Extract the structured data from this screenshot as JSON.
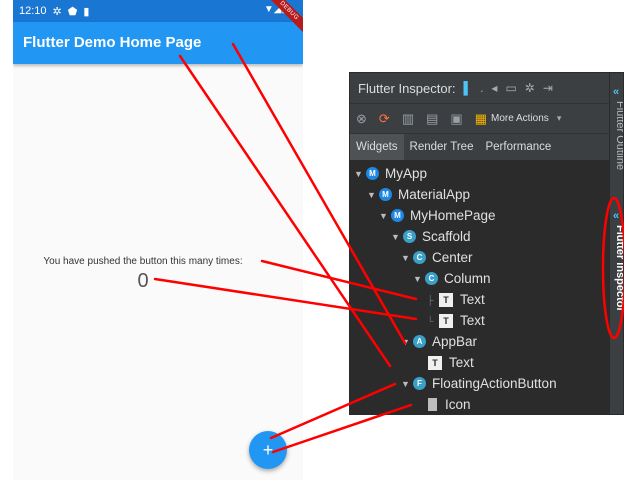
{
  "phone": {
    "status_time": "12:10",
    "debug_banner": "DEBUG",
    "appbar_title": "Flutter Demo Home Page",
    "counter_caption": "You have pushed the button this many times:",
    "counter_value": "0",
    "fab_glyph": "+"
  },
  "inspector": {
    "title": "Flutter Inspector:",
    "more_actions": "More Actions",
    "tabs": [
      {
        "label": "Widgets",
        "active": true
      },
      {
        "label": "Render Tree",
        "active": false
      },
      {
        "label": "Performance",
        "active": false
      }
    ],
    "tree": [
      {
        "label": "MyApp",
        "badge": "M",
        "expanded": true
      },
      {
        "label": "MaterialApp",
        "badge": "M",
        "expanded": true
      },
      {
        "label": "MyHomePage",
        "badge": "M",
        "expanded": true
      },
      {
        "label": "Scaffold",
        "badge": "S",
        "expanded": true
      },
      {
        "label": "Center",
        "badge": "C",
        "expanded": true
      },
      {
        "label": "Column",
        "badge": "C",
        "expanded": true
      },
      {
        "label": "Text",
        "badge": "T",
        "expanded": null
      },
      {
        "label": "Text",
        "badge": "T",
        "expanded": null
      },
      {
        "label": "AppBar",
        "badge": "A",
        "expanded": true
      },
      {
        "label": "Text",
        "badge": "T",
        "expanded": null
      },
      {
        "label": "FloatingActionButton",
        "badge": "F",
        "expanded": true
      },
      {
        "label": "Icon",
        "badge": "",
        "expanded": null
      }
    ],
    "side_tabs": [
      "Flutter Outline",
      "Flutter Inspector"
    ]
  },
  "colors": {
    "appbar": "#2196f3",
    "statusbar": "#1976d2",
    "pointer": "#ff0000",
    "badge_material": "#1e88e5",
    "badge_scaffold": "#3aa0c8"
  }
}
